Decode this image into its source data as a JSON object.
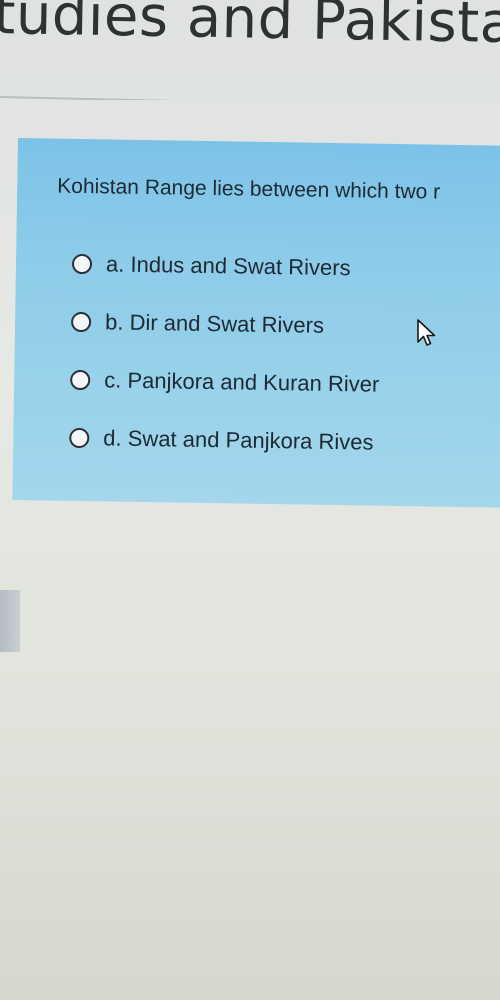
{
  "header": {
    "title": "tudies and Pakistan"
  },
  "question": {
    "text": "Kohistan Range lies between which two r",
    "options": [
      {
        "label": "a. Indus and Swat Rivers"
      },
      {
        "label": "b. Dir and Swat Rivers"
      },
      {
        "label": "c. Panjkora and Kuran River"
      },
      {
        "label": "d. Swat and Panjkora Rives"
      }
    ]
  },
  "icons": {
    "cursor": "mouse-pointer-icon"
  },
  "colors": {
    "card_background": "#8ccbe9",
    "text": "#1e2a33",
    "page_background": "#e3e6e1"
  }
}
